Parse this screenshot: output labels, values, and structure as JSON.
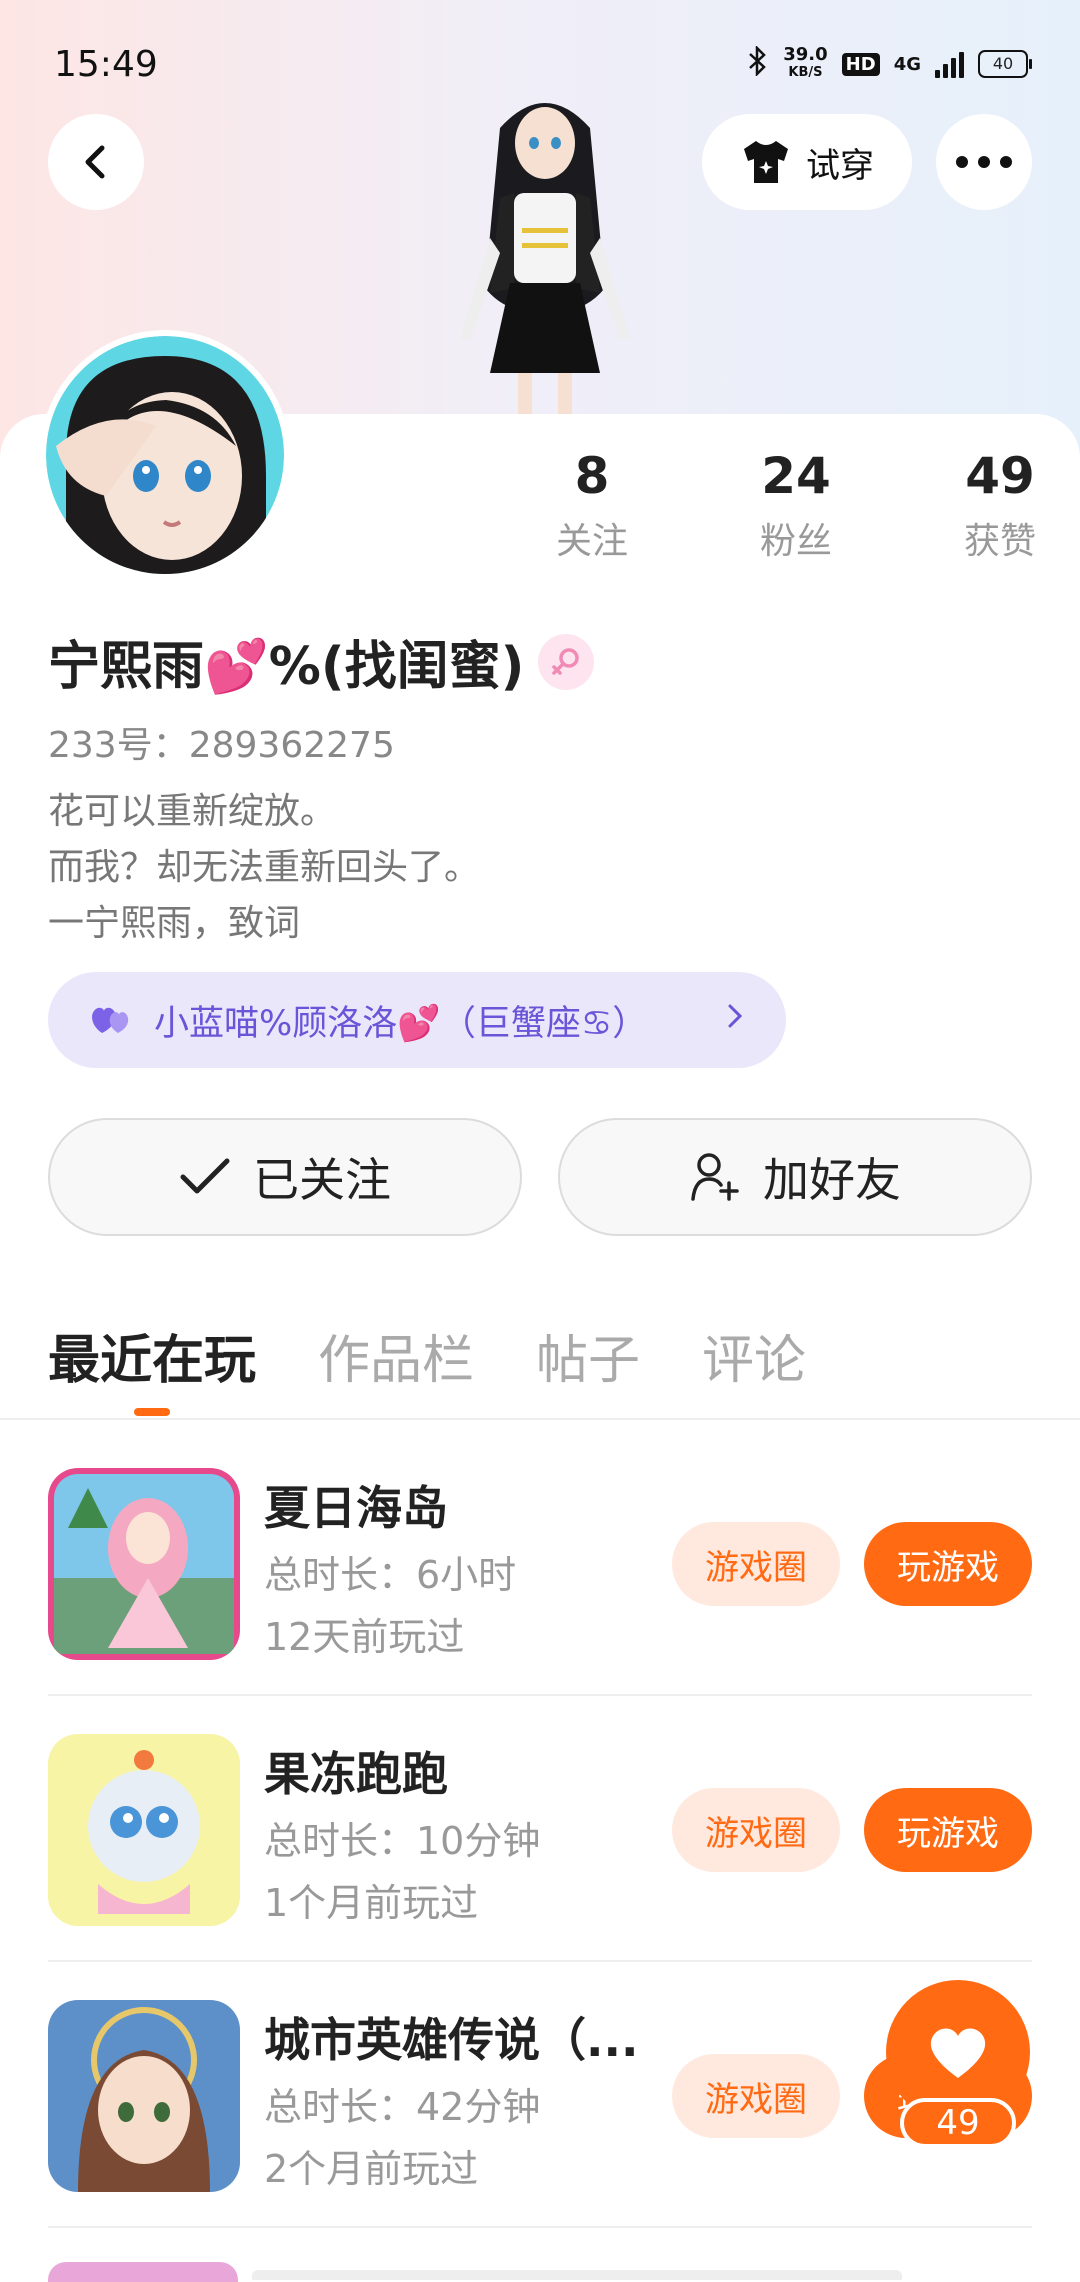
{
  "status_bar": {
    "time": "15:49",
    "net_speed_value": "39.0",
    "net_speed_unit": "KB/S",
    "hd_label": "HD",
    "network_type": "4G",
    "battery": "40"
  },
  "header": {
    "try_on_label": "试穿"
  },
  "stats": [
    {
      "value": "8",
      "label": "关注"
    },
    {
      "value": "24",
      "label": "粉丝"
    },
    {
      "value": "49",
      "label": "获赞"
    }
  ],
  "profile": {
    "nickname": "宁熙雨💕%(找闺蜜)",
    "gender": "female",
    "uid": "233号：289362275",
    "bio": [
      "花可以重新绽放。",
      "而我？却无法重新回头了。",
      "一宁熙雨，致词"
    ]
  },
  "relation": {
    "text": "小蓝喵%顾洛洛💕（巨蟹座♋）"
  },
  "actions": {
    "follow_label": "已关注",
    "add_friend_label": "加好友"
  },
  "tabs": [
    {
      "label": "最近在玩",
      "active": true
    },
    {
      "label": "作品栏",
      "active": false
    },
    {
      "label": "帖子",
      "active": false
    },
    {
      "label": "评论",
      "active": false
    }
  ],
  "games": [
    {
      "name": "夏日海岛",
      "duration": "总时长：6小时",
      "last_played": "12天前玩过",
      "circle_label": "游戏圈",
      "play_label": "玩游戏"
    },
    {
      "name": "果冻跑跑",
      "duration": "总时长：10分钟",
      "last_played": "1个月前玩过",
      "circle_label": "游戏圈",
      "play_label": "玩游戏"
    },
    {
      "name": "城市英雄传说（...",
      "duration": "总时长：42分钟",
      "last_played": "2个月前玩过",
      "circle_label": "游戏圈",
      "play_label": "玩游戏"
    }
  ],
  "like_fab": {
    "count": "49"
  },
  "colors": {
    "accent": "#ff6a13",
    "relation_bg": "#ebe7fb",
    "relation_text": "#6a55d8"
  }
}
